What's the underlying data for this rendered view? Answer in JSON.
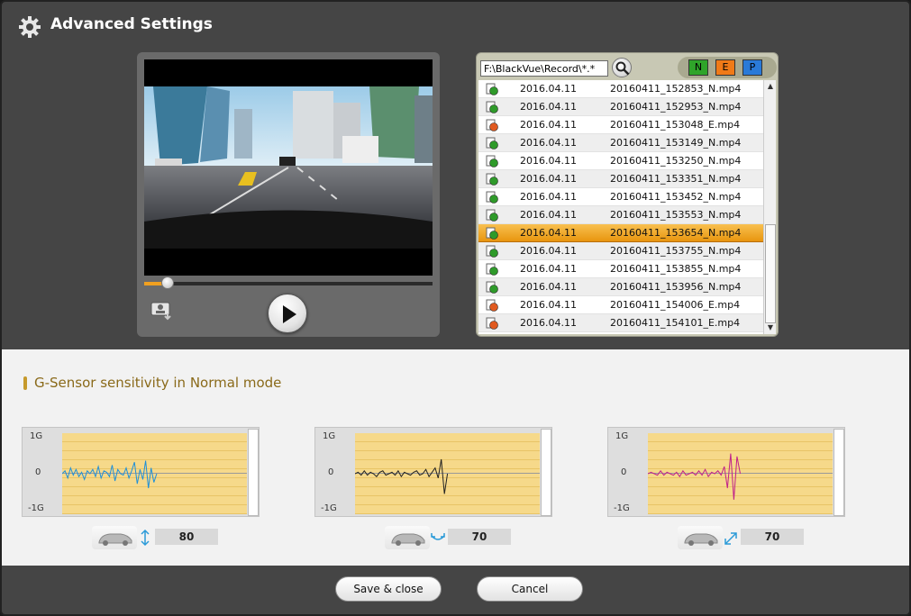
{
  "window": {
    "title": "Advanced Settings",
    "title_icon": "gear-icon"
  },
  "player": {
    "seek_progress_percent": 8,
    "capture_icon": "capture-icon",
    "play_icon": "play-icon"
  },
  "file_list": {
    "path": "F:\\BlackVue\\Record\\*.*",
    "search_icon": "search-icon",
    "filters": [
      {
        "label": "N",
        "color": "#2fa42a"
      },
      {
        "label": "E",
        "color": "#f07a18"
      },
      {
        "label": "P",
        "color": "#2a7ad8"
      }
    ],
    "selected_index": 8,
    "rows": [
      {
        "type": "N",
        "date": "2016.04.11",
        "file": "20160411_152853_N.mp4"
      },
      {
        "type": "N",
        "date": "2016.04.11",
        "file": "20160411_152953_N.mp4"
      },
      {
        "type": "E",
        "date": "2016.04.11",
        "file": "20160411_153048_E.mp4"
      },
      {
        "type": "N",
        "date": "2016.04.11",
        "file": "20160411_153149_N.mp4"
      },
      {
        "type": "N",
        "date": "2016.04.11",
        "file": "20160411_153250_N.mp4"
      },
      {
        "type": "N",
        "date": "2016.04.11",
        "file": "20160411_153351_N.mp4"
      },
      {
        "type": "N",
        "date": "2016.04.11",
        "file": "20160411_153452_N.mp4"
      },
      {
        "type": "N",
        "date": "2016.04.11",
        "file": "20160411_153553_N.mp4"
      },
      {
        "type": "N",
        "date": "2016.04.11",
        "file": "20160411_153654_N.mp4"
      },
      {
        "type": "N",
        "date": "2016.04.11",
        "file": "20160411_153755_N.mp4"
      },
      {
        "type": "N",
        "date": "2016.04.11",
        "file": "20160411_153855_N.mp4"
      },
      {
        "type": "N",
        "date": "2016.04.11",
        "file": "20160411_153956_N.mp4"
      },
      {
        "type": "E",
        "date": "2016.04.11",
        "file": "20160411_154006_E.mp4"
      },
      {
        "type": "E",
        "date": "2016.04.11",
        "file": "20160411_154101_E.mp4"
      }
    ]
  },
  "sensor": {
    "heading": "G-Sensor sensitivity in Normal mode",
    "axis_labels": {
      "top": "1G",
      "mid": "0",
      "bottom": "-1G"
    },
    "panels": [
      {
        "axis_icon": "vertical-arrow-icon",
        "value": "80",
        "wave_color": "#1f8fd8"
      },
      {
        "axis_icon": "horizontal-arrow-icon",
        "value": "70",
        "wave_color": "#222222"
      },
      {
        "axis_icon": "diagonal-arrow-icon",
        "value": "70",
        "wave_color": "#c0208a"
      }
    ]
  },
  "footer": {
    "save_label": "Save & close",
    "cancel_label": "Cancel"
  }
}
